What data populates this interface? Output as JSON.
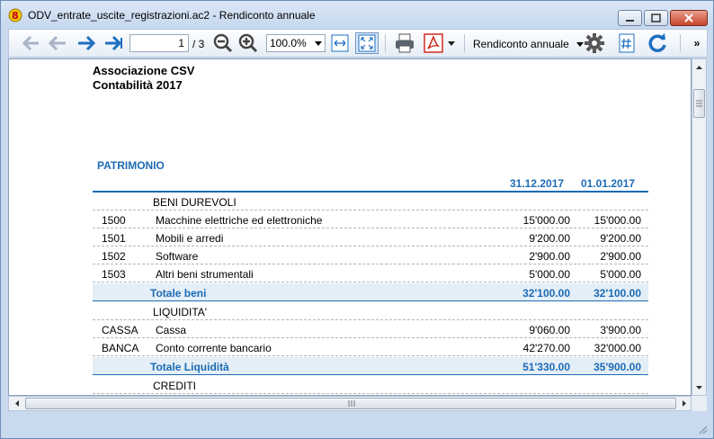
{
  "window": {
    "title": "ODV_entrate_uscite_registrazioni.ac2 - Rendiconto annuale"
  },
  "toolbar": {
    "page_current": "1",
    "page_total": "/ 3",
    "zoom": "100.0%",
    "report": "Rendiconto annuale",
    "overflow": "»"
  },
  "report": {
    "org_name": "Associazione CSV",
    "subtitle": "Contabilità 2017",
    "section": "PATRIMONIO",
    "col1": "31.12.2017",
    "col2": "01.01.2017",
    "rows": [
      {
        "acc": "",
        "desc": "BENI DUREVOLI",
        "v1": "",
        "v2": ""
      },
      {
        "acc": "1500",
        "desc": "Macchine elettriche ed elettroniche",
        "v1": "15'000.00",
        "v2": "15'000.00"
      },
      {
        "acc": "1501",
        "desc": "Mobili e arredi",
        "v1": "9'200.00",
        "v2": "9'200.00"
      },
      {
        "acc": "1502",
        "desc": "Software",
        "v1": "2'900.00",
        "v2": "2'900.00"
      },
      {
        "acc": "1503",
        "desc": "Altri beni strumentali",
        "v1": "5'000.00",
        "v2": "5'000.00"
      },
      {
        "acc": "",
        "desc": "Totale beni",
        "v1": "32'100.00",
        "v2": "32'100.00"
      },
      {
        "acc": "",
        "desc": "LIQUIDITA'",
        "v1": "",
        "v2": ""
      },
      {
        "acc": "CASSA",
        "desc": "Cassa",
        "v1": "9'060.00",
        "v2": "3'900.00"
      },
      {
        "acc": "BANCA",
        "desc": "Conto corrente bancario",
        "v1": "42'270.00",
        "v2": "32'000.00"
      },
      {
        "acc": "",
        "desc": "Totale Liquidità",
        "v1": "51'330.00",
        "v2": "35'900.00"
      },
      {
        "acc": "",
        "desc": "CREDITI",
        "v1": "",
        "v2": ""
      }
    ]
  },
  "icons": {
    "nav_color": "#1f6fc0",
    "nav_disabled_color": "#a8b4c4",
    "pdf_color": "#d22b20"
  }
}
